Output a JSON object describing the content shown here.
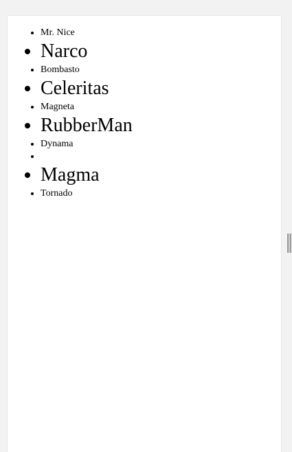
{
  "heroes": [
    {
      "name": "Mr. Nice",
      "size": "small"
    },
    {
      "name": "Narco",
      "size": "big"
    },
    {
      "name": "Bombasto",
      "size": "small"
    },
    {
      "name": "Celeritas",
      "size": "big"
    },
    {
      "name": "Magneta",
      "size": "small"
    },
    {
      "name": "RubberMan",
      "size": "big"
    },
    {
      "name": "Dynama",
      "size": "small"
    },
    {
      "name": "",
      "size": "empty"
    },
    {
      "name": "Magma",
      "size": "big"
    },
    {
      "name": "Tornado",
      "size": "small"
    }
  ]
}
